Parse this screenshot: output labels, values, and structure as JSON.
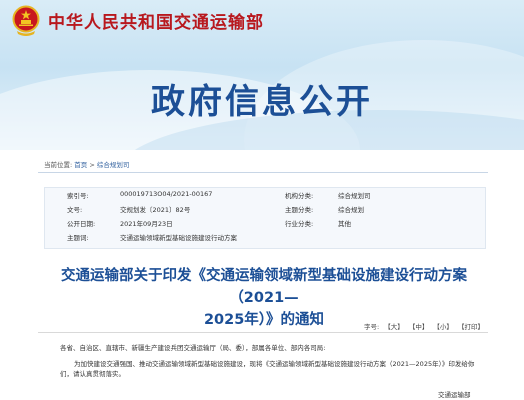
{
  "header": {
    "ministry_name": "中华人民共和国交通运输部",
    "section_title": "政府信息公开"
  },
  "breadcrumb": {
    "prefix": "当前位置:",
    "home": "首页",
    "separator": ">",
    "section": "综合规划司"
  },
  "info": {
    "rows": [
      {
        "l1": "索引号:",
        "v1": "000019713O04/2021-00167",
        "l2": "机构分类:",
        "v2": "综合规划司"
      },
      {
        "l1": "文号:",
        "v1": "交规划发〔2021〕82号",
        "l2": "主题分类:",
        "v2": "综合规划"
      },
      {
        "l1": "公开日期:",
        "v1": "2021年09月23日",
        "l2": "行业分类:",
        "v2": "其他"
      },
      {
        "l1": "主题词:",
        "v1": "交通运输领域新型基础设施建设行动方案",
        "l2": "",
        "v2": ""
      }
    ]
  },
  "document": {
    "title_line1": "交通运输部关于印发《交通运输领域新型基础设施建设行动方案（2021—",
    "title_line2": "2025年）》的通知",
    "font_label": "字号:",
    "font_large": "【大】",
    "font_medium": "【中】",
    "font_small": "【小】",
    "print": "【打印】",
    "greeting": "各省、自治区、直辖市、新疆生产建设兵团交通运输厅（局、委），部属各单位、部内各司局:",
    "body": "为加快建设交通强国、推动交通运输领域新型基础设施建设，现将《交通运输领域新型基础设施建设行动方案（2021—2025年）》印发给你们，请认真贯彻落实。",
    "signature": "交通运输部"
  }
}
